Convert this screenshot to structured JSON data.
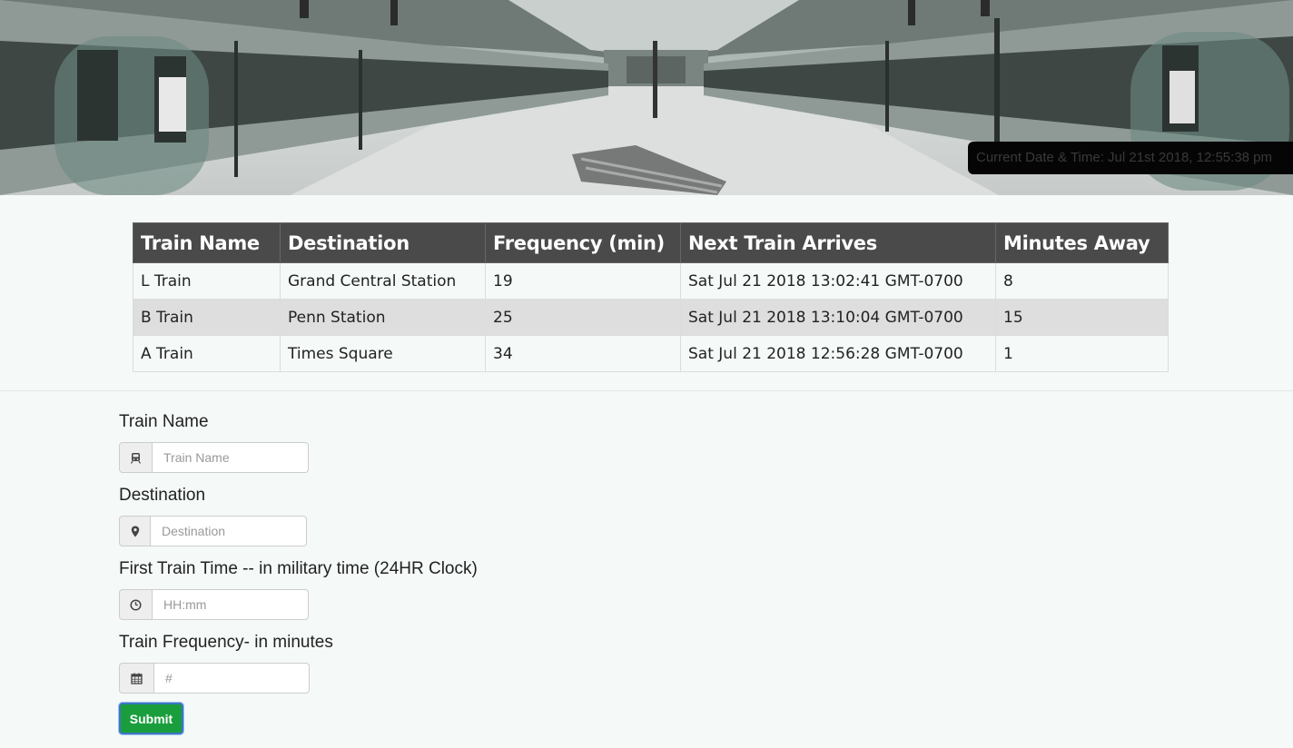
{
  "header": {
    "clock_label": "Current Date & Time: Jul 21st 2018, 12:55:38 pm"
  },
  "table": {
    "columns": [
      "Train Name",
      "Destination",
      "Frequency (min)",
      "Next Train Arrives",
      "Minutes Away"
    ],
    "rows": [
      [
        "L Train",
        "Grand Central Station",
        "19",
        "Sat Jul 21 2018 13:02:41 GMT-0700",
        "8"
      ],
      [
        "B Train",
        "Penn Station",
        "25",
        "Sat Jul 21 2018 13:10:04 GMT-0700",
        "15"
      ],
      [
        "A Train",
        "Times Square",
        "34",
        "Sat Jul 21 2018 12:56:28 GMT-0700",
        "1"
      ]
    ]
  },
  "form": {
    "train_name": {
      "label": "Train Name",
      "placeholder": "Train Name",
      "value": "",
      "icon": "train-icon"
    },
    "destination": {
      "label": "Destination",
      "placeholder": "Destination",
      "value": "",
      "icon": "map-marker-icon"
    },
    "first_train": {
      "label": "First Train Time -- in military time (24HR Clock)",
      "placeholder": "HH:mm",
      "value": "",
      "icon": "clock-icon"
    },
    "frequency": {
      "label": "Train Frequency- in minutes",
      "placeholder": "#",
      "value": "",
      "icon": "calendar-icon"
    },
    "submit_label": "Submit"
  },
  "colors": {
    "table_header": "#4a4a4a",
    "row_stripe": "#dedede",
    "submit_green": "#1a9e3d",
    "page_bg": "#f5faf8"
  }
}
